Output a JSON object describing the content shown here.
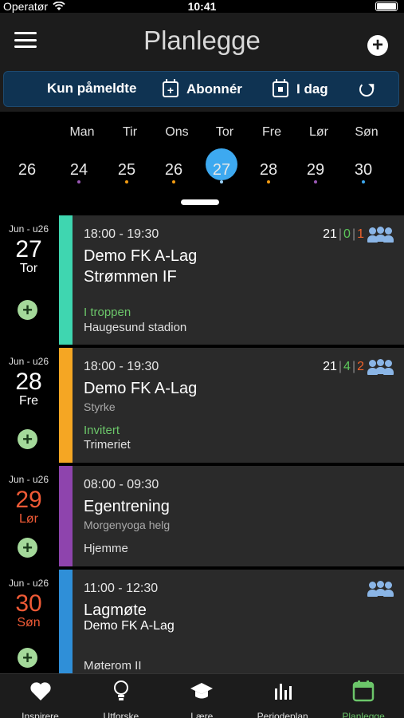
{
  "status": {
    "carrier": "Operatør",
    "time": "10:41"
  },
  "header": {
    "title": "Planlegge"
  },
  "filters": {
    "registered": "Kun påmeldte",
    "subscribe": "Abonnér",
    "today": "I dag"
  },
  "week": {
    "days": [
      "Man",
      "Tir",
      "Ons",
      "Tor",
      "Fre",
      "Lør",
      "Søn"
    ],
    "prev_date": "26",
    "dates": [
      "24",
      "25",
      "26",
      "27",
      "28",
      "29",
      "30"
    ],
    "selected_index": 3,
    "mark_colors": [
      "#9b59b6",
      "#f39c12",
      "#f39c12",
      "#9ad0f5",
      "#f39c12",
      "#9b59b6",
      "#3da9f0"
    ]
  },
  "events": [
    {
      "week": "Jun - u26",
      "day_num": "27",
      "day_name": "Tor",
      "weekend": false,
      "color": "#3fd6b0",
      "time": "18:00 - 19:30",
      "title": "Demo FK A-Lag",
      "title2": "Strømmen IF",
      "subtitle": "",
      "status": "I troppen",
      "location": "Haugesund stadion",
      "counts": [
        "21",
        "0",
        "1"
      ],
      "team_icon": true
    },
    {
      "week": "Jun - u26",
      "day_num": "28",
      "day_name": "Fre",
      "weekend": false,
      "color": "#f5a623",
      "time": "18:00 - 19:30",
      "title": "Demo FK A-Lag",
      "title2": "",
      "subtitle": "Styrke",
      "status": "Invitert",
      "location": "Trimeriet",
      "counts": [
        "21",
        "4",
        "2"
      ],
      "team_icon": true
    },
    {
      "week": "Jun - u26",
      "day_num": "29",
      "day_name": "Lør",
      "weekend": true,
      "color": "#8e44ad",
      "time": "08:00 - 09:30",
      "title": "Egentrening",
      "title2": "",
      "subtitle": "Morgenyoga helg",
      "status": "",
      "location": "Hjemme",
      "counts": [],
      "team_icon": false
    },
    {
      "week": "Jun - u26",
      "day_num": "30",
      "day_name": "Søn",
      "weekend": true,
      "color": "#2f8fd8",
      "time": "11:00 - 12:30",
      "title": "Lagmøte",
      "title2": "Demo FK A-Lag",
      "subtitle": "",
      "status": "",
      "location": "Møterom II",
      "counts": [],
      "team_icon": true
    }
  ],
  "count_colors": [
    "#ffffff",
    "#5cc65a",
    "#f0632c"
  ],
  "tabs": [
    {
      "label": "Inspirere",
      "icon": "heart-icon"
    },
    {
      "label": "Utforske",
      "icon": "lightbulb-icon"
    },
    {
      "label": "Lære",
      "icon": "graduation-cap-icon"
    },
    {
      "label": "Periodeplan",
      "icon": "bar-chart-icon"
    },
    {
      "label": "Planlegge",
      "icon": "calendar-icon",
      "active": true
    }
  ]
}
